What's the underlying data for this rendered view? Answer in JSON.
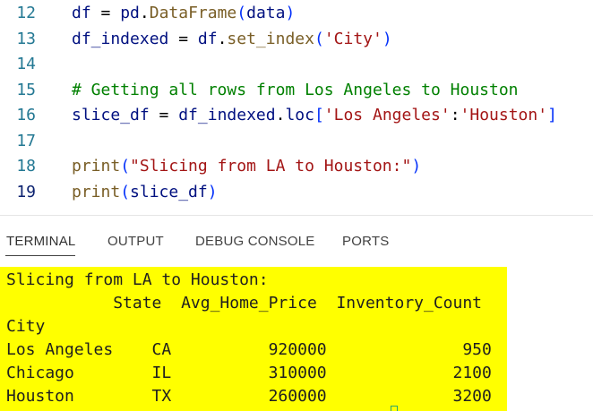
{
  "editor": {
    "lines": [
      {
        "number": "12",
        "tokens": [
          {
            "t": "var",
            "v": "df"
          },
          {
            "t": "op",
            "v": " = "
          },
          {
            "t": "var",
            "v": "pd"
          },
          {
            "t": "punct",
            "v": "."
          },
          {
            "t": "fn",
            "v": "DataFrame"
          },
          {
            "t": "brace1",
            "v": "("
          },
          {
            "t": "var",
            "v": "data"
          },
          {
            "t": "brace1",
            "v": ")"
          }
        ]
      },
      {
        "number": "13",
        "tokens": [
          {
            "t": "var",
            "v": "df_indexed"
          },
          {
            "t": "op",
            "v": " = "
          },
          {
            "t": "var",
            "v": "df"
          },
          {
            "t": "punct",
            "v": "."
          },
          {
            "t": "fn",
            "v": "set_index"
          },
          {
            "t": "brace1",
            "v": "("
          },
          {
            "t": "str",
            "v": "'City'"
          },
          {
            "t": "brace1",
            "v": ")"
          }
        ]
      },
      {
        "number": "14",
        "tokens": []
      },
      {
        "number": "15",
        "tokens": [
          {
            "t": "com",
            "v": "# Getting all rows from Los Angeles to Houston"
          }
        ]
      },
      {
        "number": "16",
        "tokens": [
          {
            "t": "var",
            "v": "slice_df"
          },
          {
            "t": "op",
            "v": " = "
          },
          {
            "t": "var",
            "v": "df_indexed"
          },
          {
            "t": "punct",
            "v": "."
          },
          {
            "t": "var",
            "v": "loc"
          },
          {
            "t": "brace1",
            "v": "["
          },
          {
            "t": "str",
            "v": "'Los Angeles'"
          },
          {
            "t": "punct",
            "v": ":"
          },
          {
            "t": "str",
            "v": "'Houston'"
          },
          {
            "t": "brace1",
            "v": "]"
          }
        ]
      },
      {
        "number": "17",
        "tokens": []
      },
      {
        "number": "18",
        "tokens": [
          {
            "t": "fn",
            "v": "print"
          },
          {
            "t": "brace1",
            "v": "("
          },
          {
            "t": "str",
            "v": "\"Slicing from LA to Houston:\""
          },
          {
            "t": "brace1",
            "v": ")"
          }
        ]
      },
      {
        "number": "19",
        "active": true,
        "tokens": [
          {
            "t": "fn",
            "v": "print"
          },
          {
            "t": "brace1",
            "v": "("
          },
          {
            "t": "var",
            "v": "slice_df"
          },
          {
            "t": "brace1",
            "v": ")"
          }
        ]
      }
    ]
  },
  "panel": {
    "tabs": [
      {
        "label": "TERMINAL",
        "active": true
      },
      {
        "label": "OUTPUT",
        "active": false
      },
      {
        "label": "DEBUG CONSOLE",
        "active": false
      },
      {
        "label": "PORTS",
        "active": false
      }
    ],
    "terminal_lines": [
      "Slicing from LA to Houston:",
      "           State  Avg_Home_Price  Inventory_Count",
      "City",
      "Los Angeles    CA          920000              950",
      "Chicago        IL          310000             2100",
      "Houston        TX          260000             3200"
    ]
  },
  "colors": {
    "highlight": "#ffff00",
    "line_number": "#237893",
    "comment": "#008000",
    "string": "#a31515",
    "function": "#795e26",
    "variable": "#001080"
  }
}
